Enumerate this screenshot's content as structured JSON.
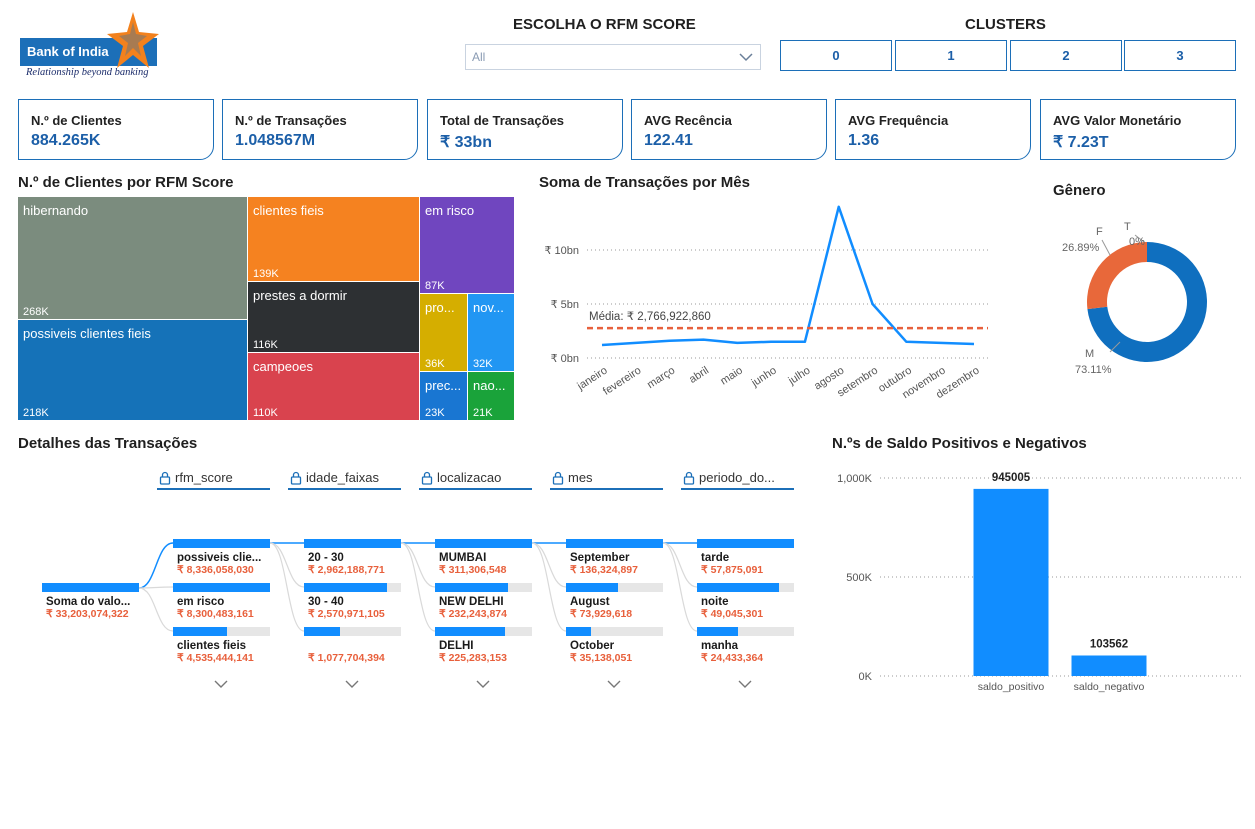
{
  "logo": {
    "name": "Bank of India",
    "tagline": "Relationship beyond banking"
  },
  "rfm_slicer": {
    "title": "ESCOLHA O RFM SCORE",
    "value": "All",
    "icon": "chevron-down-icon"
  },
  "clusters": {
    "title": "CLUSTERS",
    "buttons": [
      "0",
      "1",
      "2",
      "3"
    ]
  },
  "kpis": [
    {
      "label": "N.º de Clientes",
      "value": "884.265K"
    },
    {
      "label": "N.º de Transações",
      "value": "1.048567M"
    },
    {
      "label": "Total de Transações",
      "value": "₹ 33bn"
    },
    {
      "label": "AVG Recência",
      "value": "122.41"
    },
    {
      "label": "AVG Frequência",
      "value": "1.36"
    },
    {
      "label": "AVG Valor Monetário",
      "value": "₹ 7.23T"
    }
  ],
  "treemap": {
    "title": "N.º de Clientes por RFM Score",
    "tiles": [
      {
        "label": "hibernando",
        "value": "268K",
        "color": "#7b8c7e"
      },
      {
        "label": "possiveis clientes fieis",
        "value": "218K",
        "color": "#1572b8"
      },
      {
        "label": "clientes fieis",
        "value": "139K",
        "color": "#f58220"
      },
      {
        "label": "prestes a dormir",
        "value": "116K",
        "color": "#2d3033"
      },
      {
        "label": "campeoes",
        "value": "110K",
        "color": "#d9434e"
      },
      {
        "label": "em risco",
        "value": "87K",
        "color": "#7046bf"
      },
      {
        "label": "pro...",
        "value": "36K",
        "color": "#d5ae00"
      },
      {
        "label": "nov...",
        "value": "32K",
        "color": "#2196f3"
      },
      {
        "label": "prec...",
        "value": "23K",
        "color": "#1976d2"
      },
      {
        "label": "nao...",
        "value": "21K",
        "color": "#1aa33a"
      }
    ]
  },
  "chart_data": [
    {
      "type": "line",
      "title": "Soma de Transações por Mês",
      "categories": [
        "janeiro",
        "fevereiro",
        "março",
        "abril",
        "maio",
        "junho",
        "julho",
        "agosto",
        "setembro",
        "outubro",
        "novembro",
        "dezembro"
      ],
      "values": [
        1.2,
        1.4,
        1.6,
        1.7,
        1.4,
        1.5,
        1.5,
        14.0,
        5.0,
        1.5,
        1.4,
        1.3
      ],
      "unit": "bn",
      "yticks": [
        "₹ 0bn",
        "₹ 5bn",
        "₹ 10bn"
      ],
      "ylim": [
        0,
        15
      ],
      "average": {
        "label": "Média: ₹ 2,766,922,860",
        "value": 2.77
      },
      "colors": {
        "line": "#118dff",
        "average": "#e8603c"
      }
    },
    {
      "type": "pie",
      "title": "Gênero",
      "slices": [
        {
          "label": "M",
          "value": 73.11,
          "display": "73.11%",
          "color": "#0f6fbf"
        },
        {
          "label": "F",
          "value": 26.89,
          "display": "26.89%",
          "color": "#e8683a"
        },
        {
          "label": "T",
          "value": 0,
          "display": "0%",
          "color": "#7b8c7e"
        }
      ]
    },
    {
      "type": "bar",
      "title": "N.ºs de Saldo Positivos e Negativos",
      "categories": [
        "saldo_positivo",
        "saldo_negativo"
      ],
      "values": [
        945005,
        103562
      ],
      "data_labels": [
        "945005",
        "103562"
      ],
      "yticks": [
        "0K",
        "500K",
        "1,000K"
      ],
      "ylim": [
        0,
        1000000
      ],
      "color": "#118dff"
    }
  ],
  "decomposition": {
    "title": "Detalhes das Transações",
    "fields": [
      "rfm_score",
      "idade_faixas",
      "localizacao",
      "mes",
      "periodo_do..."
    ],
    "root": {
      "label": "Soma do valo...",
      "value": "₹ 33,203,074,322"
    },
    "columns": [
      [
        {
          "label": "possiveis clie...",
          "value": "₹ 8,336,058,030",
          "fill": 1.0
        },
        {
          "label": "em risco",
          "value": "₹ 8,300,483,161",
          "fill": 1.0
        },
        {
          "label": "clientes fieis",
          "value": "₹ 4,535,444,141",
          "fill": 0.56
        }
      ],
      [
        {
          "label": "20 - 30",
          "value": "₹ 2,962,188,771",
          "fill": 1.0
        },
        {
          "label": "30 - 40",
          "value": "₹ 2,570,971,105",
          "fill": 0.86
        },
        {
          "label": "",
          "value": "₹ 1,077,704,394",
          "fill": 0.37
        }
      ],
      [
        {
          "label": "MUMBAI",
          "value": "₹ 311,306,548",
          "fill": 1.0
        },
        {
          "label": "NEW DELHI",
          "value": "₹ 232,243,874",
          "fill": 0.75
        },
        {
          "label": "DELHI",
          "value": "₹ 225,283,153",
          "fill": 0.72
        }
      ],
      [
        {
          "label": "September",
          "value": "₹ 136,324,897",
          "fill": 1.0
        },
        {
          "label": "August",
          "value": "₹ 73,929,618",
          "fill": 0.54
        },
        {
          "label": "October",
          "value": "₹ 35,138,051",
          "fill": 0.26
        }
      ],
      [
        {
          "label": "tarde",
          "value": "₹ 57,875,091",
          "fill": 1.0
        },
        {
          "label": "noite",
          "value": "₹ 49,045,301",
          "fill": 0.85
        },
        {
          "label": "manha",
          "value": "₹ 24,433,364",
          "fill": 0.42
        }
      ]
    ]
  }
}
